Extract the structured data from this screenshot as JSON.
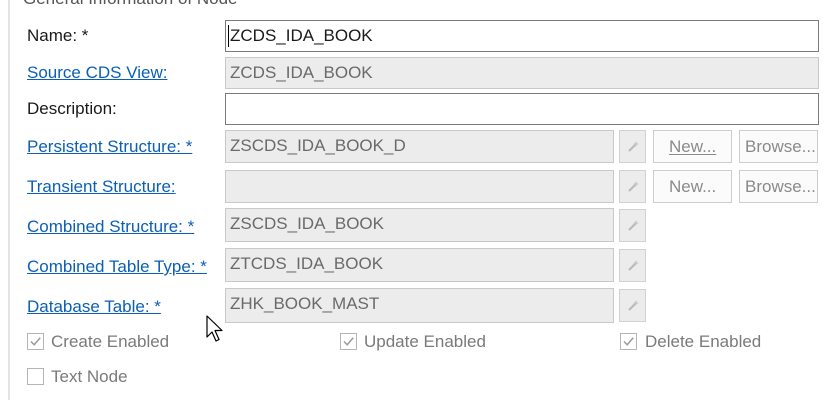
{
  "group": {
    "title": "General Information of Node"
  },
  "fields": {
    "name": {
      "label": "Name: *",
      "value": "ZCDS_IDA_BOOK"
    },
    "source_cds_view": {
      "label": "Source CDS View:",
      "value": "ZCDS_IDA_BOOK"
    },
    "description": {
      "label": "Description:",
      "value": ""
    },
    "persistent_structure": {
      "label": "Persistent Structure: *",
      "value": "ZSCDS_IDA_BOOK_D"
    },
    "transient_structure": {
      "label": "Transient Structure:",
      "value": ""
    },
    "combined_structure": {
      "label": "Combined Structure: *",
      "value": "ZSCDS_IDA_BOOK"
    },
    "combined_table_type": {
      "label": "Combined Table Type: *",
      "value": "ZTCDS_IDA_BOOK"
    },
    "database_table": {
      "label": "Database Table: *",
      "value": "ZHK_BOOK_MAST"
    }
  },
  "buttons": {
    "new_label": "New...",
    "browse_label": "Browse..."
  },
  "checkboxes": {
    "create_enabled": {
      "label": "Create Enabled",
      "checked": true
    },
    "update_enabled": {
      "label": "Update Enabled",
      "checked": true
    },
    "delete_enabled": {
      "label": "Delete Enabled",
      "checked": true
    },
    "text_node": {
      "label": "Text Node",
      "checked": false
    }
  },
  "icons": {
    "wand": "magic-wand-icon",
    "check": "checkmark-icon",
    "pointer": "mouse-pointer-icon"
  }
}
